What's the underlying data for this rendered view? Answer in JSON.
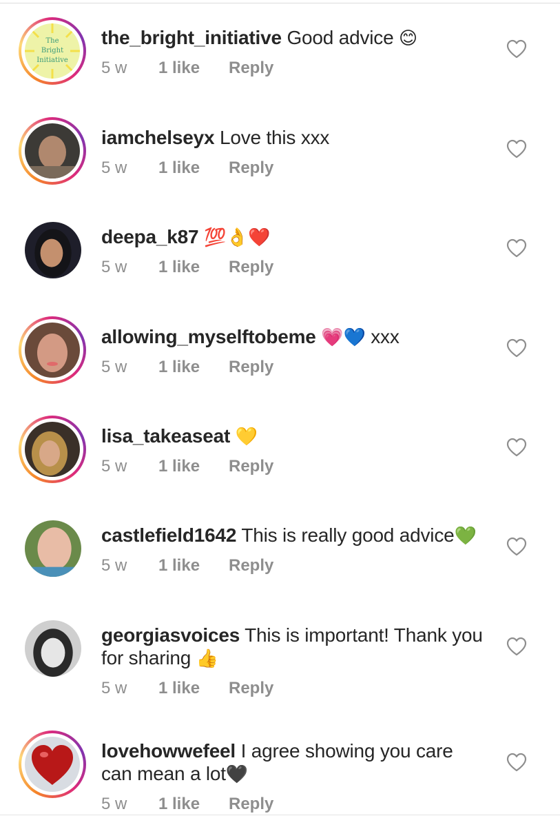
{
  "colors": {
    "text": "#262626",
    "meta": "#8e8e8e",
    "heart_outline": "#8e8e8e",
    "story_ring": [
      "#f58529",
      "#feda77",
      "#dd2a7b",
      "#8134af"
    ]
  },
  "logo": {
    "line1": "The",
    "line2": "Bright",
    "line3": "Initiative"
  },
  "comments": [
    {
      "username": "the_bright_initiative",
      "text": "Good advice",
      "emoji": "😊",
      "time": "5 w",
      "likes": "1 like",
      "reply": "Reply",
      "avatar_icon": "bright-initiative-logo",
      "story_ring": true
    },
    {
      "username": "iamchelseyx",
      "text": "Love this xxx",
      "emoji": "",
      "time": "5 w",
      "likes": "1 like",
      "reply": "Reply",
      "avatar_icon": "user-photo",
      "story_ring": true
    },
    {
      "username": "deepa_k87",
      "text": "",
      "emoji": "💯👌❤️",
      "time": "5 w",
      "likes": "1 like",
      "reply": "Reply",
      "avatar_icon": "user-photo",
      "story_ring": false
    },
    {
      "username": "allowing_myselftobeme",
      "text": "xxx",
      "emoji": "💗💙",
      "time": "5 w",
      "likes": "1 like",
      "reply": "Reply",
      "avatar_icon": "user-photo",
      "story_ring": true
    },
    {
      "username": "lisa_takeaseat",
      "text": "",
      "emoji": "💛",
      "time": "5 w",
      "likes": "1 like",
      "reply": "Reply",
      "avatar_icon": "user-photo",
      "story_ring": true
    },
    {
      "username": "castlefield1642",
      "text": "This is really good advice",
      "emoji": "💚",
      "time": "5 w",
      "likes": "1 like",
      "reply": "Reply",
      "avatar_icon": "user-photo",
      "story_ring": false
    },
    {
      "username": "georgiasvoices",
      "text": "This is important! Thank you for sharing",
      "emoji": "👍",
      "time": "5 w",
      "likes": "1 like",
      "reply": "Reply",
      "avatar_icon": "user-photo",
      "story_ring": false
    },
    {
      "username": "lovehowwefeel",
      "text": "I agree showing you care can mean a lot",
      "emoji": "🖤",
      "time": "5 w",
      "likes": "1 like",
      "reply": "Reply",
      "avatar_icon": "heart-photo",
      "story_ring": true
    }
  ]
}
